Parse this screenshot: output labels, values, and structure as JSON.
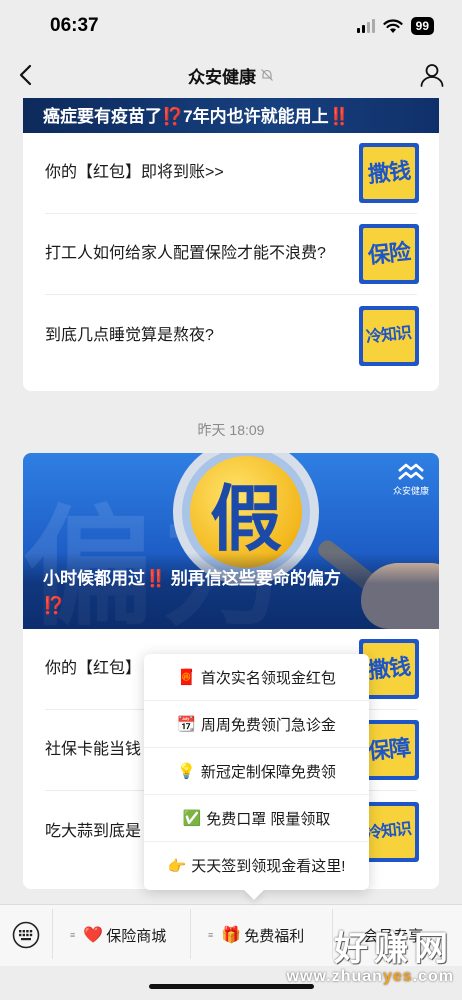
{
  "status_bar": {
    "time": "06:37",
    "battery": "99"
  },
  "nav": {
    "title": "众安健康"
  },
  "card1": {
    "banner_parts": [
      "癌症要有疫苗了",
      "⁉️",
      "7年内也许就能用上",
      "‼️"
    ],
    "items": [
      {
        "text": "你的【红包】即将到账>>",
        "thumb_text": "撒钱"
      },
      {
        "text": "打工人如何给家人配置保险才能不浪费?",
        "thumb_text": "保险"
      },
      {
        "text": "到底几点睡觉算是熬夜?",
        "thumb_text": "冷知识"
      }
    ]
  },
  "timestamp": "昨天 18:09",
  "card2": {
    "hero": {
      "big_char": "假",
      "brand": "众安健康",
      "caption_parts": [
        "小时候都用过",
        "‼️",
        " 别再信这些要命的偏方",
        "⁉️"
      ]
    },
    "items": [
      {
        "text": "你的【红包】",
        "thumb_text": "撒钱"
      },
      {
        "text": "社保卡能当钱",
        "thumb_text": "保障"
      },
      {
        "text": "吃大蒜到底是",
        "thumb_text": "冷知识"
      }
    ]
  },
  "menu": {
    "items": [
      {
        "icon": "🧧",
        "icon_name": "red-packet-icon",
        "label": "首次实名领现金红包"
      },
      {
        "icon": "📆",
        "icon_name": "calendar-icon",
        "label": "周周免费领门急诊金"
      },
      {
        "icon": "💡",
        "icon_name": "lightbulb-icon",
        "label": "新冠定制保障免费领"
      },
      {
        "icon": "✅",
        "icon_name": "check-icon",
        "label": "免费口罩 限量领取"
      },
      {
        "icon": "👉",
        "icon_name": "pointing-hand-icon",
        "label": "天天签到领现金看这里!"
      }
    ]
  },
  "tab_bar": {
    "tabs": [
      {
        "icon": "❤️",
        "icon_name": "heart-icon",
        "label": "保险商城"
      },
      {
        "icon": "🎁",
        "icon_name": "gift-icon",
        "label": "免费福利"
      },
      {
        "icon": "",
        "icon_name": "",
        "label": "会员专享"
      }
    ]
  },
  "watermark": {
    "big": "好赚网",
    "small_prefix": "www.zhuan",
    "small_yes": "yes",
    "small_suffix": ".com"
  },
  "colors": {
    "accent_blue": "#1e56c8",
    "alert_red": "#e8222b",
    "thumb_yellow": "#f7d23a"
  }
}
